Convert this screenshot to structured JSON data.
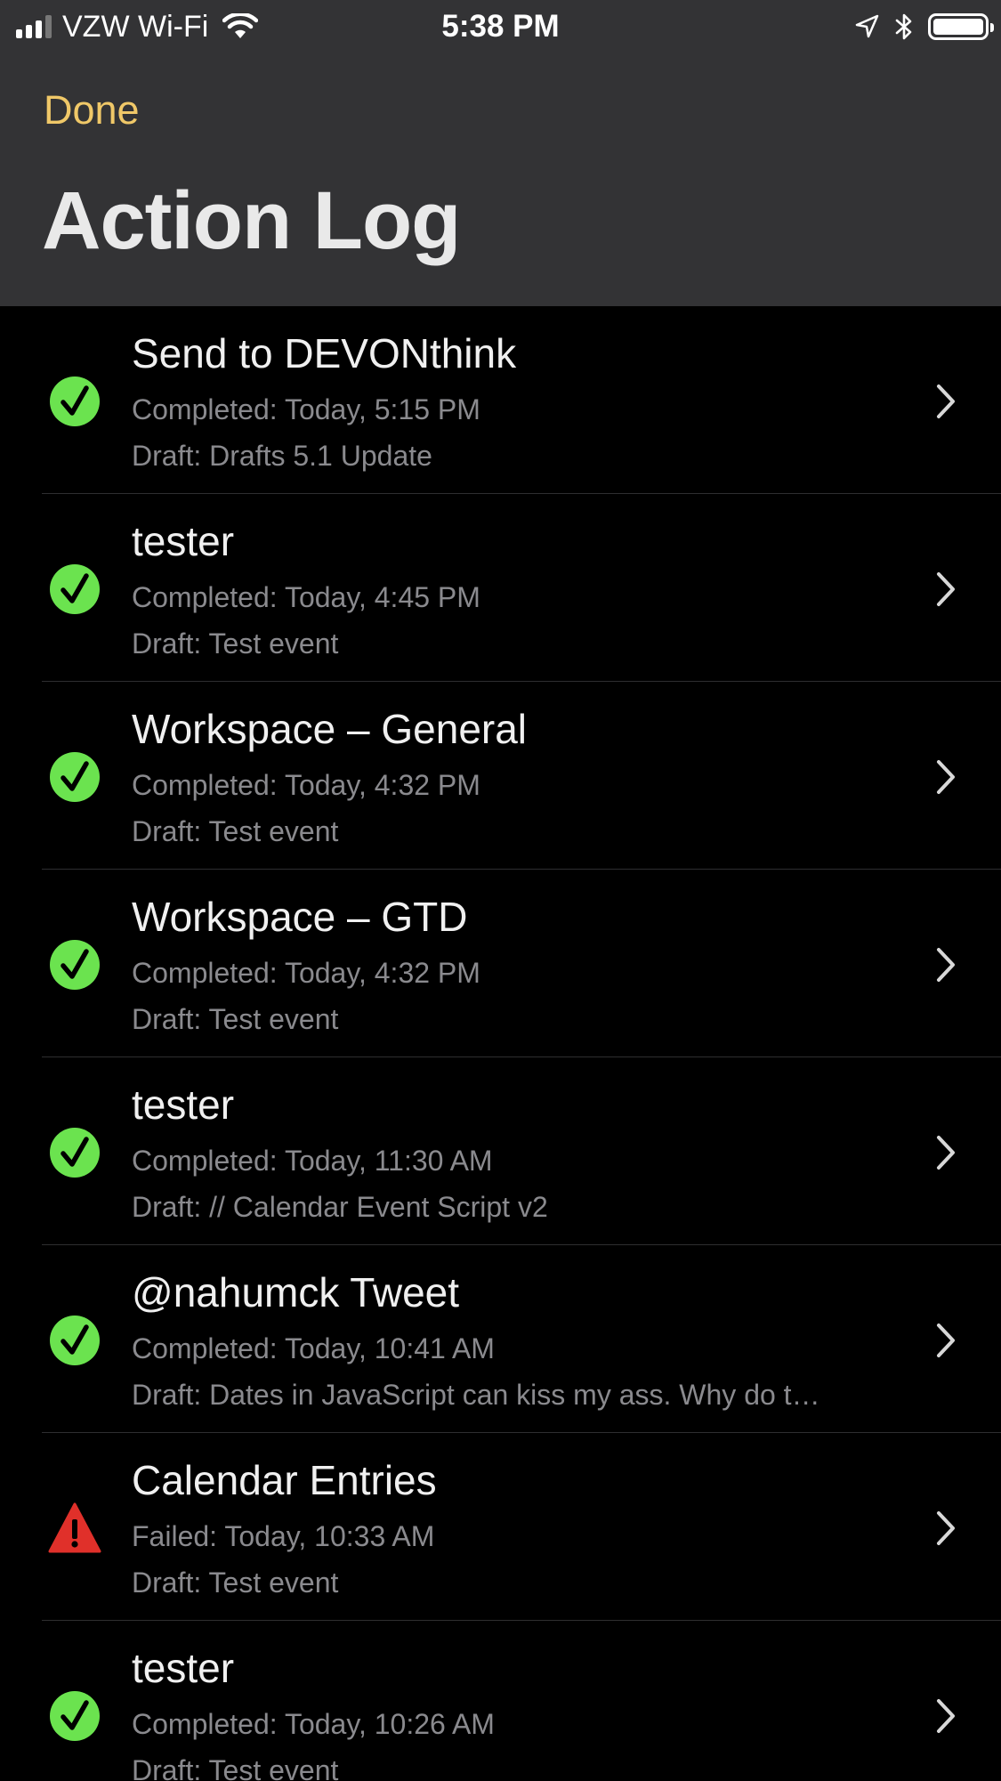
{
  "status_bar": {
    "carrier": "VZW Wi-Fi",
    "time": "5:38 PM",
    "signal_bars": 4,
    "signal_bars_filled": 3,
    "battery_level": 1.0
  },
  "nav": {
    "done_label": "Done",
    "title": "Action Log"
  },
  "colors": {
    "accent": "#f0c868",
    "success": "#6be34f",
    "failure": "#e0302a",
    "header_bg": "#333335",
    "list_bg": "#000000"
  },
  "log_entries": [
    {
      "title": "Send to DEVONthink",
      "status_text": "Completed: Today, 5:15 PM",
      "draft_text": "Draft: Drafts 5.1 Update",
      "result": "success",
      "icon": "checkmark-circle-icon"
    },
    {
      "title": "tester",
      "status_text": "Completed: Today, 4:45 PM",
      "draft_text": "Draft: Test event",
      "result": "success",
      "icon": "checkmark-circle-icon"
    },
    {
      "title": "Workspace – General",
      "status_text": "Completed: Today, 4:32 PM",
      "draft_text": "Draft: Test event",
      "result": "success",
      "icon": "checkmark-circle-icon"
    },
    {
      "title": "Workspace – GTD",
      "status_text": "Completed: Today, 4:32 PM",
      "draft_text": "Draft: Test event",
      "result": "success",
      "icon": "checkmark-circle-icon"
    },
    {
      "title": "tester",
      "status_text": "Completed: Today, 11:30 AM",
      "draft_text": "Draft: // Calendar Event Script v2",
      "result": "success",
      "icon": "checkmark-circle-icon"
    },
    {
      "title": "@nahumck Tweet",
      "status_text": "Completed: Today, 10:41 AM",
      "draft_text": "Draft: Dates in JavaScript can kiss my ass. Why do t…",
      "result": "success",
      "icon": "checkmark-circle-icon"
    },
    {
      "title": "Calendar Entries",
      "status_text": "Failed: Today, 10:33 AM",
      "draft_text": "Draft: Test event",
      "result": "failure",
      "icon": "warning-triangle-icon"
    },
    {
      "title": "tester",
      "status_text": "Completed: Today, 10:26 AM",
      "draft_text": "Draft: Test event",
      "result": "success",
      "icon": "checkmark-circle-icon"
    }
  ]
}
